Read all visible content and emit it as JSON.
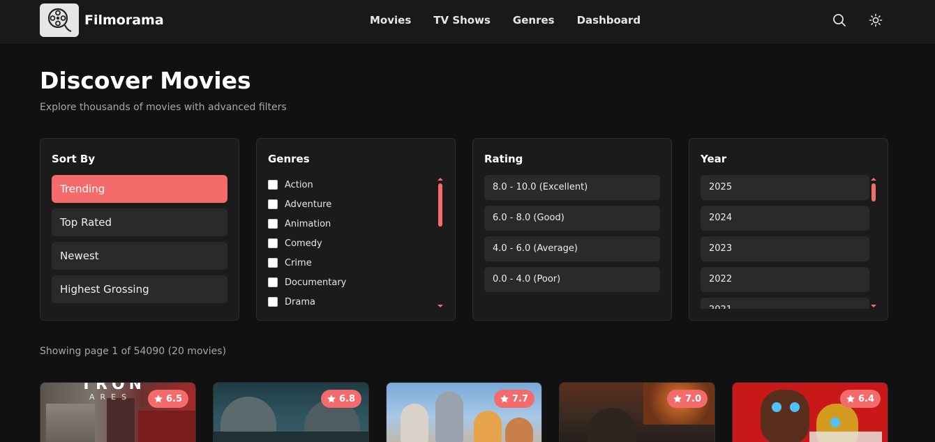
{
  "header": {
    "brand": "Filmorama",
    "nav": [
      "Movies",
      "TV Shows",
      "Genres",
      "Dashboard"
    ]
  },
  "hero": {
    "title": "Discover Movies",
    "subtitle": "Explore thousands of movies with advanced filters"
  },
  "filters": {
    "sort": {
      "title": "Sort By",
      "options": [
        "Trending",
        "Top Rated",
        "Newest",
        "Highest Grossing"
      ],
      "active": "Trending"
    },
    "genres": {
      "title": "Genres",
      "options": [
        "Action",
        "Adventure",
        "Animation",
        "Comedy",
        "Crime",
        "Documentary",
        "Drama"
      ]
    },
    "rating": {
      "title": "Rating",
      "options": [
        "8.0 - 10.0 (Excellent)",
        "6.0 - 8.0 (Good)",
        "4.0 - 6.0 (Average)",
        "0.0 - 4.0 (Poor)"
      ]
    },
    "year": {
      "title": "Year",
      "options": [
        "2025",
        "2024",
        "2023",
        "2022",
        "2021"
      ]
    }
  },
  "results": {
    "showing": "Showing page 1 of 54090 (20 movies)"
  },
  "movies": [
    {
      "rating": "6.5",
      "poster_text": "TRON",
      "poster_sub": "ARES"
    },
    {
      "rating": "6.8"
    },
    {
      "rating": "7.7"
    },
    {
      "rating": "7.0"
    },
    {
      "rating": "6.4"
    }
  ],
  "colors": {
    "accent": "#f36b6b",
    "background": "#111111",
    "panel": "#1b1b1b",
    "button": "#2a2a2a"
  },
  "icons": {
    "logo": "film-reel-icon",
    "search": "search-icon",
    "theme": "sun-icon",
    "rating": "star-icon"
  }
}
